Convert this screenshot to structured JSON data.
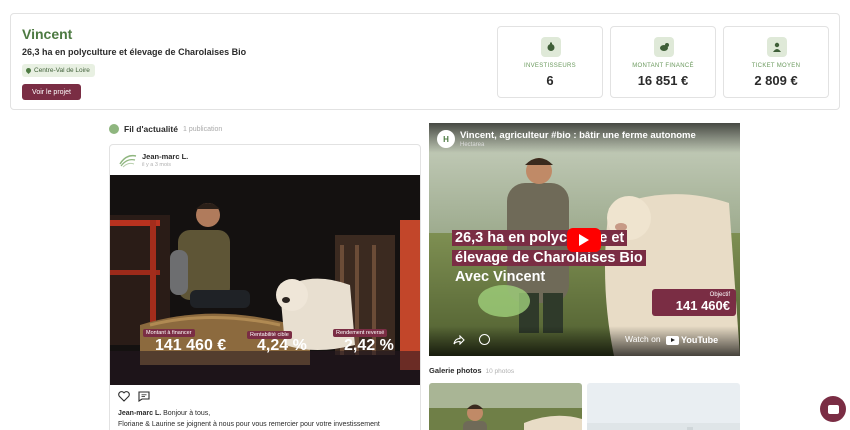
{
  "project": {
    "name": "Vincent",
    "subtitle": "26,3 ha en polyculture et élevage de Charolaises Bio",
    "location": "Centre-Val de Loire",
    "button_label": "Voir le projet"
  },
  "stats": [
    {
      "label": "INVESTISSEURS",
      "value": "6",
      "icon": "investors-icon"
    },
    {
      "label": "MONTANT FINANCÉ",
      "value": "16 851 €",
      "icon": "money-icon"
    },
    {
      "label": "TICKET MOYEN",
      "value": "2 809 €",
      "icon": "ticket-icon"
    }
  ],
  "feed": {
    "title": "Fil d'actualité",
    "count": "1 publication"
  },
  "post": {
    "author": "Jean-marc L.",
    "time": "il y a 3 mois",
    "image_labels": {
      "amount_label": "Montant à financer",
      "amount_value": "141 460 €",
      "rentability_label": "Rentabilité cible",
      "rentability_value": "4,24 %",
      "yield_label": "Rendement reversé",
      "yield_value": "2,42 %"
    },
    "text_author": "Jean-marc L.",
    "text_line1": "Bonjour à tous,",
    "text_line2": "Floriane & Laurine se joignent à nous pour vous remercier pour votre investissement"
  },
  "video": {
    "title": "Vincent, agriculteur #bio : bâtir une ferme autonome",
    "channel": "Hectarea",
    "caption_line1": "26,3 ha en polyculture et",
    "caption_line2": "élevage de Charolaises Bio",
    "caption_line3": "Avec Vincent",
    "objective_label": "Objectif",
    "objective_value": "141 460€",
    "watch_label": "Watch on",
    "youtube_label": "YouTube"
  },
  "gallery": {
    "title": "Galerie photos",
    "count": "10 photos"
  },
  "colors": {
    "brand_green": "#4d7a42",
    "brand_burgundy": "#7a2d44"
  }
}
